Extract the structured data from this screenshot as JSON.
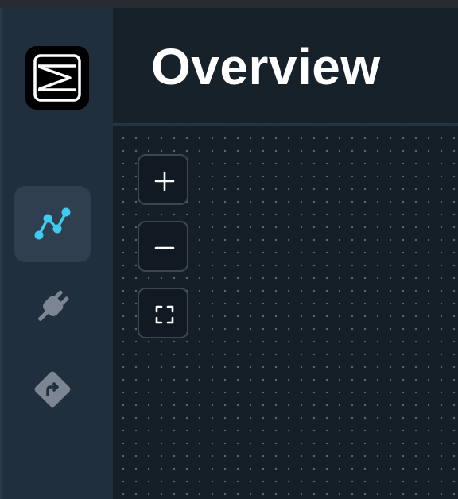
{
  "header": {
    "title": "Overview"
  },
  "sidebar": {
    "logo": {
      "icon": "logo-icon"
    },
    "items": [
      {
        "id": "graph",
        "icon": "line-graph-icon",
        "active": true,
        "color": "#3ecbf0"
      },
      {
        "id": "plugins",
        "icon": "plug-icon",
        "active": false,
        "color": "#7c8693"
      },
      {
        "id": "routing",
        "icon": "route-sign-icon",
        "active": false,
        "color": "#7c8693"
      }
    ]
  },
  "canvas": {
    "background": "dot-grid",
    "controls": [
      {
        "id": "zoom-in",
        "icon": "plus-icon"
      },
      {
        "id": "zoom-out",
        "icon": "minus-icon"
      },
      {
        "id": "fit-view",
        "icon": "fit-view-icon"
      }
    ]
  },
  "colors": {
    "sidebar_bg": "#1f2f3e",
    "main_bg": "#151f28",
    "active_item_bg": "#2f3f4f",
    "accent": "#3ecbf0",
    "muted_icon": "#7c8693",
    "title": "#ffffff"
  }
}
